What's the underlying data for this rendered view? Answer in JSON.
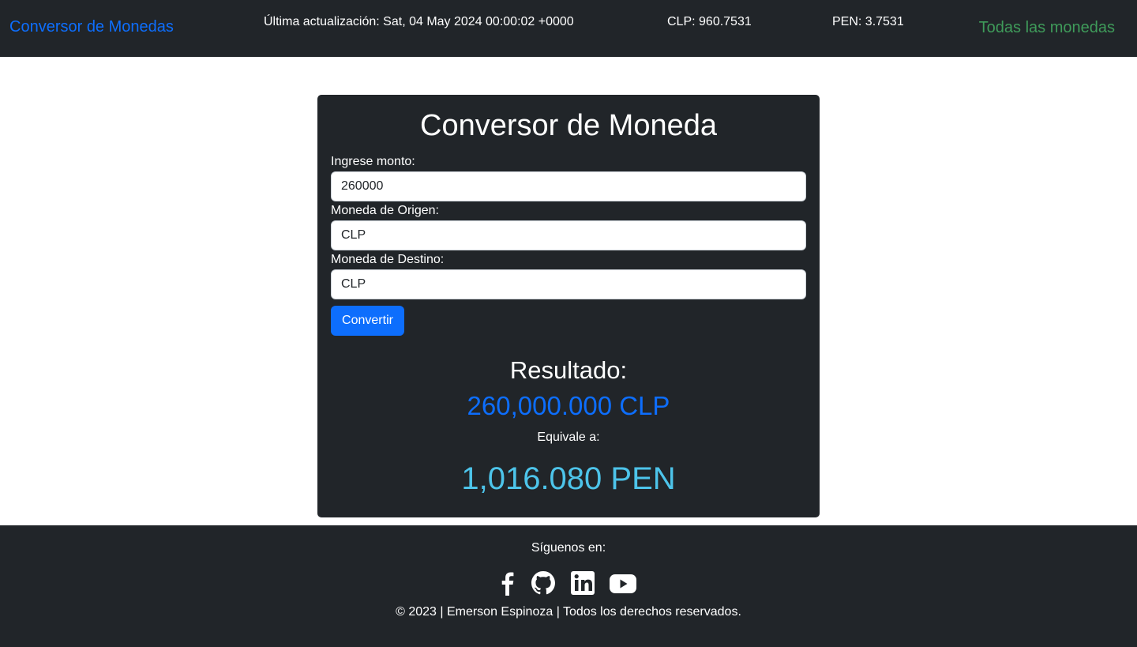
{
  "navbar": {
    "brand": "Conversor de Monedas",
    "updated": "Última actualización: Sat, 04 May 2024 00:00:02 +0000",
    "rate_clp": "CLP: 960.7531",
    "rate_pen": "PEN: 3.7531",
    "all_currencies": "Todas las monedas"
  },
  "converter": {
    "title": "Conversor de Moneda",
    "amount_label": "Ingrese monto:",
    "amount_value": "260000",
    "origin_label": "Moneda de Origen:",
    "origin_value": "CLP",
    "target_label": "Moneda de Destino:",
    "target_value": "CLP",
    "convert_button": "Convertir"
  },
  "result": {
    "heading": "Resultado:",
    "source_amount": "260,000.000 CLP",
    "equivalent_label": "Equivale a:",
    "target_amount": "1,016.080 PEN"
  },
  "footer": {
    "follow_label": "Síguenos en:",
    "social_icons": [
      "facebook-icon",
      "github-icon",
      "linkedin-icon",
      "youtube-icon"
    ],
    "copyright": "© 2023 | Emerson Espinoza | Todos los derechos reservados."
  },
  "colors": {
    "dark_bg": "#212529",
    "primary": "#0d6efd",
    "success_link": "#3f9b5a",
    "info": "#4dc4ea"
  }
}
